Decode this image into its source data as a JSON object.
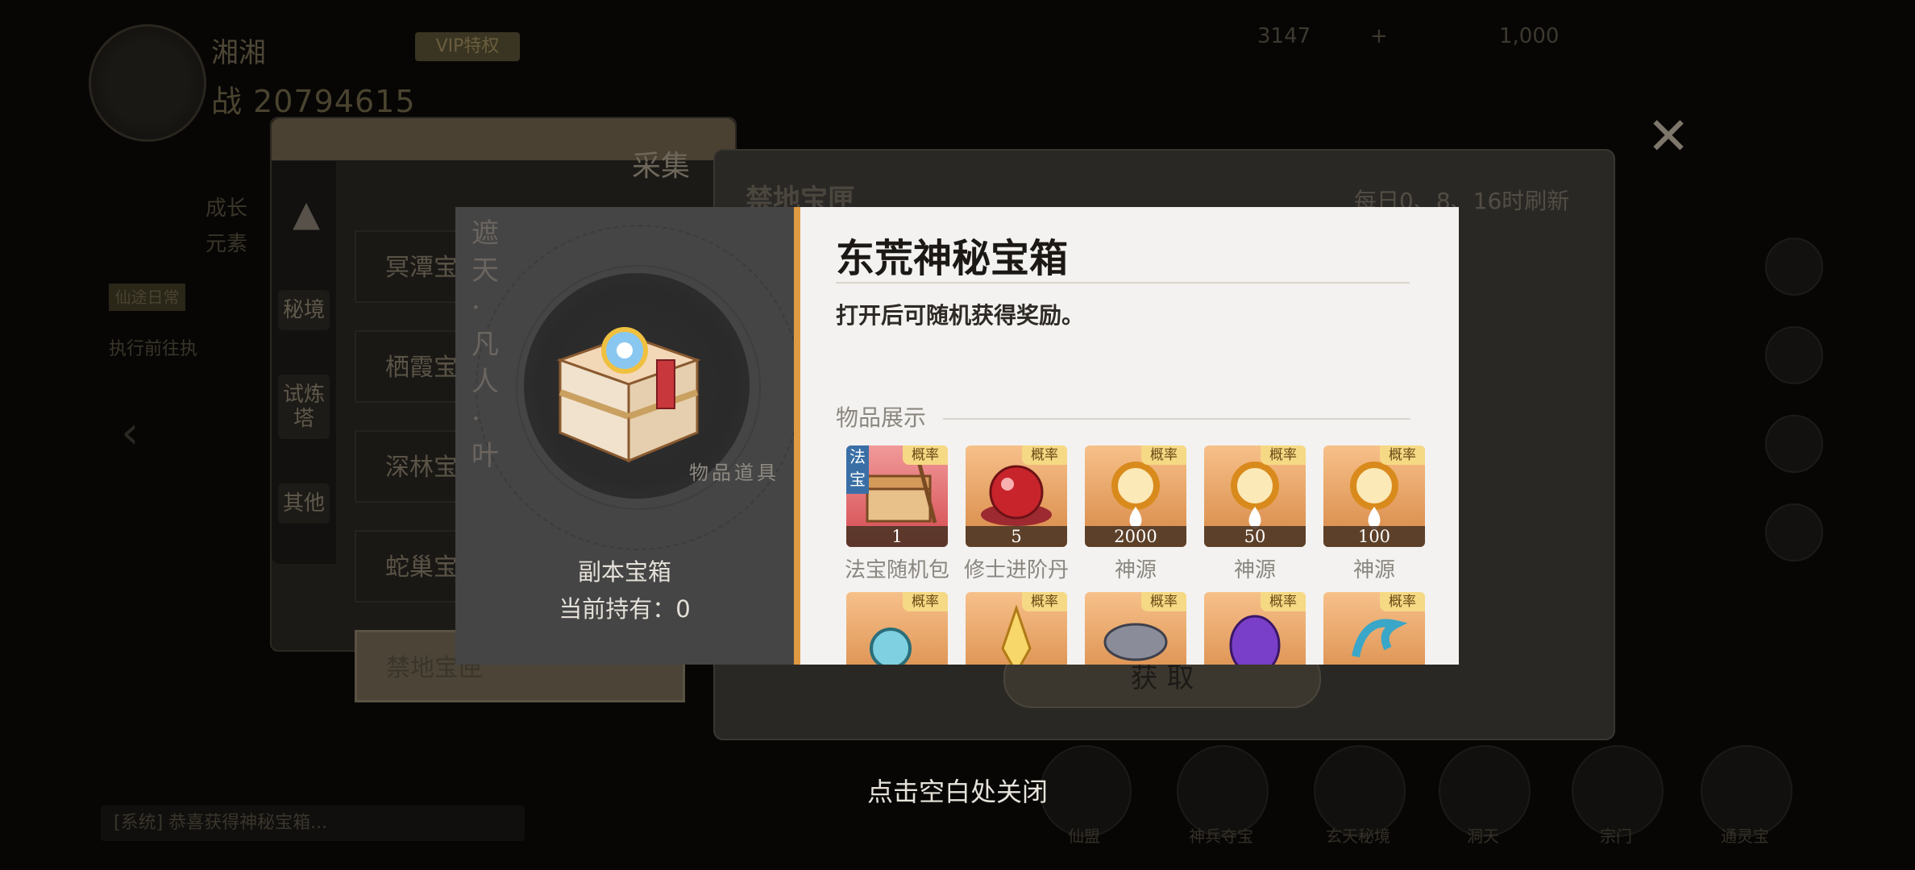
{
  "hud": {
    "player_name": "湘湘",
    "vip_label": "VIP特权",
    "power": "战 20794615",
    "resource_1": "3147",
    "resource_2": "+",
    "resource_3": "1,000",
    "quest_text_1": "成长",
    "quest_text_2": "元素",
    "quest_badge": "仙途日常",
    "quest_text_3": "执行前往执",
    "bottom_labels": [
      "仙盟",
      "神兵夺宝",
      "玄天秘境",
      "洞天",
      "宗门",
      "通灵宝"
    ],
    "chat_text": "[系统] 恭喜获得神秘宝箱..."
  },
  "collect_window": {
    "title": "采集",
    "side_tabs": [
      "秘境",
      "试炼塔",
      "其他"
    ],
    "list": [
      "冥潭宝匣",
      "栖霞宝匣",
      "深林宝匣",
      "蛇巢宝匣",
      "禁地宝匣"
    ]
  },
  "vault_window": {
    "title": "禁地宝匣",
    "refresh": "每日0、8、16时刷新",
    "get_button": "获 取"
  },
  "popup": {
    "left_vertical_text": "遮天·凡人·叶",
    "left_circle_text": "物品道具",
    "item_name": "副本宝箱",
    "item_count": "当前持有：0",
    "title": "东荒神秘宝箱",
    "description": "打开后可随机获得奖励。",
    "section_title": "物品展示",
    "rate_badge": "概率",
    "items": [
      {
        "name": "法宝随机包",
        "qty": "1",
        "tag": "法宝",
        "icon": "treasure-chest-icon",
        "bg": "red"
      },
      {
        "name": "修士进阶丹",
        "qty": "5",
        "tag": "",
        "icon": "red-pill-icon",
        "bg": "orange"
      },
      {
        "name": "神源",
        "qty": "2000",
        "tag": "",
        "icon": "divine-source-icon",
        "bg": "orange"
      },
      {
        "name": "神源",
        "qty": "50",
        "tag": "",
        "icon": "divine-source-icon",
        "bg": "orange"
      },
      {
        "name": "神源",
        "qty": "100",
        "tag": "",
        "icon": "divine-source-icon",
        "bg": "orange"
      },
      {
        "name": "",
        "qty": "",
        "tag": "",
        "icon": "jade-ornament-icon",
        "bg": "orange"
      },
      {
        "name": "",
        "qty": "",
        "tag": "",
        "icon": "golden-leaf-icon",
        "bg": "orange"
      },
      {
        "name": "",
        "qty": "",
        "tag": "",
        "icon": "stone-icon",
        "bg": "orange"
      },
      {
        "name": "",
        "qty": "",
        "tag": "",
        "icon": "purple-gem-icon",
        "bg": "orange"
      },
      {
        "name": "",
        "qty": "",
        "tag": "",
        "icon": "dragon-icon",
        "bg": "orange"
      }
    ]
  },
  "close_hint": "点击空白处关闭",
  "colors": {
    "accent": "#e09a42",
    "rate_badge": "#f6d984",
    "cell_bg": "#e8a25e"
  }
}
